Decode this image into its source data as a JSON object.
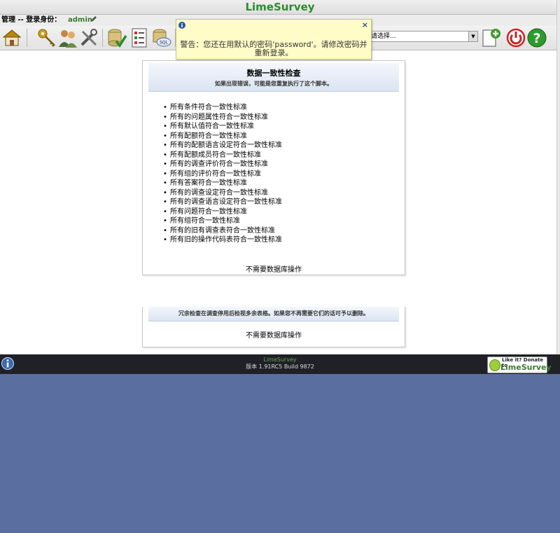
{
  "app_title": "LimeSurvey",
  "login": {
    "label": "管理 -- 登录身份：",
    "user": "admin"
  },
  "toolbar": {
    "icons": [
      "home-icon",
      "keys-icon",
      "users-icon",
      "tools-icon",
      "database-check-icon",
      "checklist-icon",
      "sql-database-icon",
      "add-survey-icon",
      "logout-icon",
      "help-icon"
    ],
    "select_placeholder": "请选择..."
  },
  "warning": {
    "message": "警告：您还在用默认的密码'password'。请修改密码并重新登录。"
  },
  "integrity_panel": {
    "title": "数据一致性检查",
    "subtitle": "如果出现错误，可能是您重复执行了这个脚本。",
    "checks": [
      "所有条件符合一致性标准",
      "所有的问题属性符合一致性标准",
      "所有默认值符合一致性标准",
      "所有配额符合一致性标准",
      "所有的配额语言设定符合一致性标准",
      "所有配额成员符合一致性标准",
      "所有的调查评价符合一致性标准",
      "所有组的评价符合一致性标准",
      "所有答案符合一致性标准",
      "所有的调查设定符合一致性标准",
      "所有的调查语言设定符合一致性标准",
      "所有问题符合一致性标准",
      "所有组符合一致性标准",
      "所有的旧有调查表符合一致性标准",
      "所有旧的操作代码表符合一致性标准"
    ],
    "result": "不需要数据库操作"
  },
  "redundancy_panel": {
    "subtitle": "冗余检查在调查停用后检视多余表格。如果您不再需要它们的话可予以删除。",
    "result": "不需要数据库操作"
  },
  "footer": {
    "app_name": "LimeSurvey",
    "version": "版本 1.91RC5 Build 9872",
    "donate_line1": "Like it? Donate to",
    "donate_line2": "LimeSurvey"
  },
  "colors": {
    "brand_green": "#2e8b2e",
    "warning_bg": "#fffcc7",
    "footer_bg": "#1f2126",
    "page_bg_outside": "#5a6f9f"
  }
}
